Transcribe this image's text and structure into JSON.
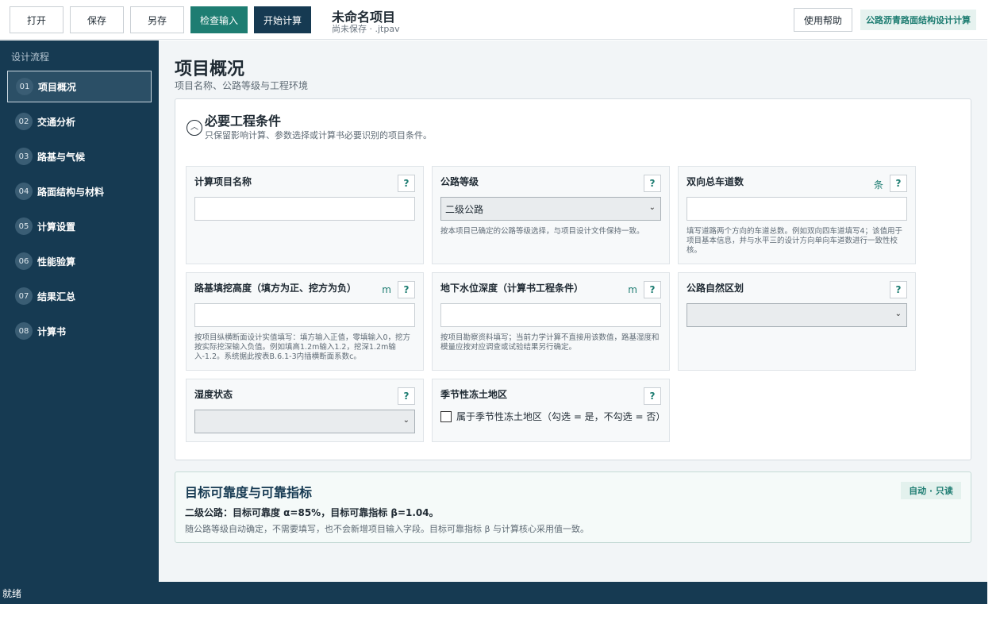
{
  "toolbar": {
    "open": "打开",
    "save": "保存",
    "save_as": "另存",
    "check": "检查输入",
    "calculate": "开始计算",
    "project_name": "未命名项目",
    "project_status": "尚未保存 · .jtpav",
    "help": "使用帮助",
    "brand": "公路沥青路面结构设计计算"
  },
  "sidebar": {
    "heading": "设计流程",
    "items": [
      {
        "num": "01",
        "label": "项目概况"
      },
      {
        "num": "02",
        "label": "交通分析"
      },
      {
        "num": "03",
        "label": "路基与气候"
      },
      {
        "num": "04",
        "label": "路面结构与材料"
      },
      {
        "num": "05",
        "label": "计算设置"
      },
      {
        "num": "06",
        "label": "性能验算"
      },
      {
        "num": "07",
        "label": "结果汇总"
      },
      {
        "num": "08",
        "label": "计算书"
      }
    ]
  },
  "page": {
    "title": "项目概况",
    "subtitle": "项目名称、公路等级与工程环境"
  },
  "required": {
    "collapse_glyph": "︿",
    "title": "必要工程条件",
    "subtitle": "只保留影响计算、参数选择或计算书必要识别的项目条件。",
    "help_glyph": "?",
    "fields": {
      "project_name": {
        "label": "计算项目名称",
        "value": ""
      },
      "road_grade": {
        "label": "公路等级",
        "value": "二级公路",
        "help": "按本项目已确定的公路等级选择，与项目设计文件保持一致。"
      },
      "lanes": {
        "label": "双向总车道数",
        "unit": "条",
        "value": "",
        "help": "填写道路两个方向的车道总数。例如双向四车道填写4；该值用于项目基本信息，并与水平三的设计方向单向车道数进行一致性校核。"
      },
      "fill_height": {
        "label": "路基填挖高度（填方为正、挖方为负）",
        "unit": "m",
        "value": "",
        "help": "按项目纵横断面设计实值填写：填方输入正值，零填输入0，挖方按实际挖深输入负值。例如填高1.2m输入1.2，挖深1.2m输入-1.2。系统据此按表B.6.1-3内插横断面系数c。"
      },
      "groundwater": {
        "label": "地下水位深度（计算书工程条件）",
        "unit": "m",
        "value": "",
        "help": "按项目勘察资料填写；当前力学计算不直接用该数值，路基湿度和模量应按对应调查或试验结果另行确定。"
      },
      "natural_zone": {
        "label": "公路自然区划",
        "value": ""
      },
      "humidity": {
        "label": "湿度状态",
        "value": ""
      },
      "frost": {
        "label": "季节性冻土地区",
        "checkbox_label": "属于季节性冻土地区（勾选 = 是，不勾选 = 否）"
      }
    }
  },
  "reliability": {
    "title": "目标可靠度与可靠指标",
    "badge": "自动 · 只读",
    "main": "二级公路：目标可靠度 α=85%，目标可靠指标 β=1.04。",
    "note": "随公路等级自动确定，不需要填写，也不会新增项目输入字段。目标可靠指标 β 与计算核心采用值一致。"
  },
  "status": {
    "text": "就绪"
  }
}
